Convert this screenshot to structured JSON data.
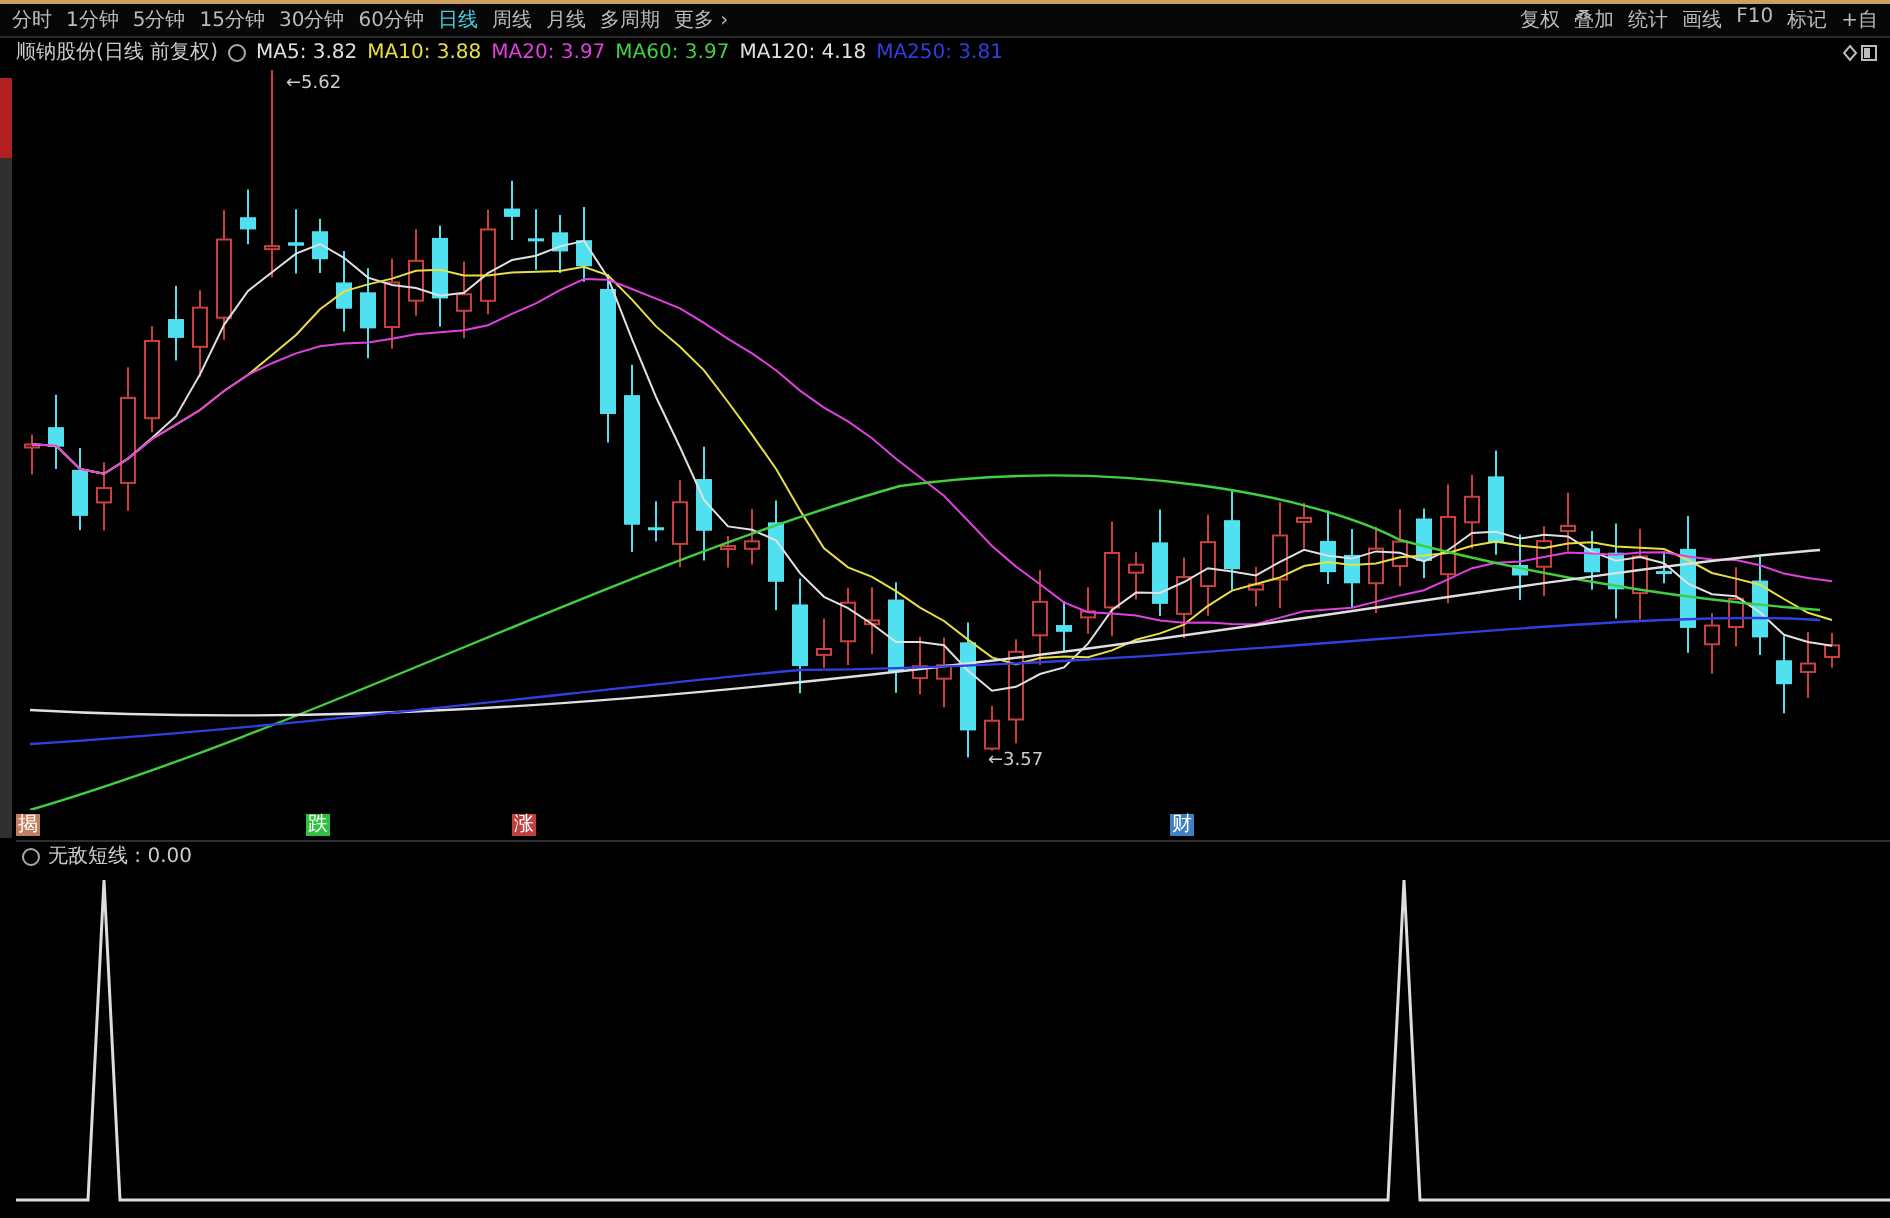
{
  "toolbar": {
    "periods": [
      {
        "label": "分时",
        "selected": false
      },
      {
        "label": "1分钟",
        "selected": false
      },
      {
        "label": "5分钟",
        "selected": false
      },
      {
        "label": "15分钟",
        "selected": false
      },
      {
        "label": "30分钟",
        "selected": false
      },
      {
        "label": "60分钟",
        "selected": false
      },
      {
        "label": "日线",
        "selected": true
      },
      {
        "label": "周线",
        "selected": false
      },
      {
        "label": "月线",
        "selected": false
      },
      {
        "label": "多周期",
        "selected": false
      },
      {
        "label": "更多 ›",
        "selected": false
      }
    ],
    "tools": [
      "复权",
      "叠加",
      "统计",
      "画线",
      "F10",
      "标记",
      "+自"
    ]
  },
  "legend": {
    "title": "顺钠股份(日线 前复权)",
    "items": [
      {
        "label": "MA5: 3.82",
        "color": "#e0e0e0"
      },
      {
        "label": "MA10: 3.88",
        "color": "#e8e040"
      },
      {
        "label": "MA20: 3.97",
        "color": "#e040e0"
      },
      {
        "label": "MA60: 3.97",
        "color": "#40d040"
      },
      {
        "label": "MA120: 4.18",
        "color": "#e0e0e0"
      },
      {
        "label": "MA250: 3.81",
        "color": "#3040e0"
      }
    ]
  },
  "chart": {
    "high_label": "←5.62",
    "low_label": "←3.57"
  },
  "markers": [
    {
      "label": "揭",
      "color": "#c08060"
    },
    {
      "label": "跌",
      "color": "#30c040"
    },
    {
      "label": "涨",
      "color": "#c04040"
    },
    {
      "label": "财",
      "color": "#4080c0"
    }
  ],
  "indicator": {
    "label": "无敌短线 : 0.00"
  }
}
